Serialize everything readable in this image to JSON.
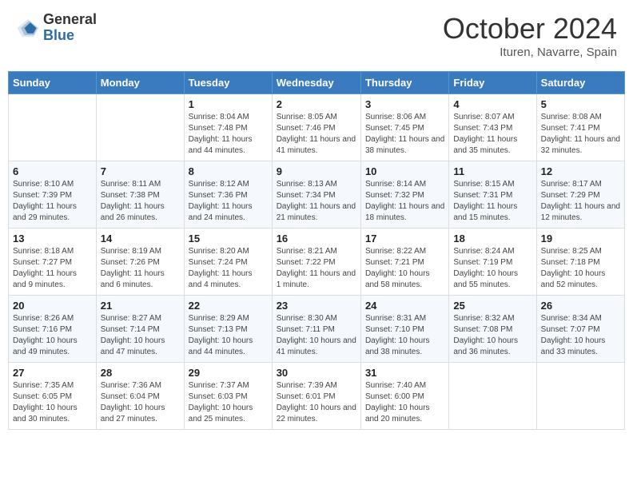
{
  "header": {
    "logo_general": "General",
    "logo_blue": "Blue",
    "month_title": "October 2024",
    "subtitle": "Ituren, Navarre, Spain"
  },
  "weekdays": [
    "Sunday",
    "Monday",
    "Tuesday",
    "Wednesday",
    "Thursday",
    "Friday",
    "Saturday"
  ],
  "weeks": [
    [
      null,
      null,
      {
        "day": "1",
        "sunrise": "Sunrise: 8:04 AM",
        "sunset": "Sunset: 7:48 PM",
        "daylight": "Daylight: 11 hours and 44 minutes."
      },
      {
        "day": "2",
        "sunrise": "Sunrise: 8:05 AM",
        "sunset": "Sunset: 7:46 PM",
        "daylight": "Daylight: 11 hours and 41 minutes."
      },
      {
        "day": "3",
        "sunrise": "Sunrise: 8:06 AM",
        "sunset": "Sunset: 7:45 PM",
        "daylight": "Daylight: 11 hours and 38 minutes."
      },
      {
        "day": "4",
        "sunrise": "Sunrise: 8:07 AM",
        "sunset": "Sunset: 7:43 PM",
        "daylight": "Daylight: 11 hours and 35 minutes."
      },
      {
        "day": "5",
        "sunrise": "Sunrise: 8:08 AM",
        "sunset": "Sunset: 7:41 PM",
        "daylight": "Daylight: 11 hours and 32 minutes."
      }
    ],
    [
      {
        "day": "6",
        "sunrise": "Sunrise: 8:10 AM",
        "sunset": "Sunset: 7:39 PM",
        "daylight": "Daylight: 11 hours and 29 minutes."
      },
      {
        "day": "7",
        "sunrise": "Sunrise: 8:11 AM",
        "sunset": "Sunset: 7:38 PM",
        "daylight": "Daylight: 11 hours and 26 minutes."
      },
      {
        "day": "8",
        "sunrise": "Sunrise: 8:12 AM",
        "sunset": "Sunset: 7:36 PM",
        "daylight": "Daylight: 11 hours and 24 minutes."
      },
      {
        "day": "9",
        "sunrise": "Sunrise: 8:13 AM",
        "sunset": "Sunset: 7:34 PM",
        "daylight": "Daylight: 11 hours and 21 minutes."
      },
      {
        "day": "10",
        "sunrise": "Sunrise: 8:14 AM",
        "sunset": "Sunset: 7:32 PM",
        "daylight": "Daylight: 11 hours and 18 minutes."
      },
      {
        "day": "11",
        "sunrise": "Sunrise: 8:15 AM",
        "sunset": "Sunset: 7:31 PM",
        "daylight": "Daylight: 11 hours and 15 minutes."
      },
      {
        "day": "12",
        "sunrise": "Sunrise: 8:17 AM",
        "sunset": "Sunset: 7:29 PM",
        "daylight": "Daylight: 11 hours and 12 minutes."
      }
    ],
    [
      {
        "day": "13",
        "sunrise": "Sunrise: 8:18 AM",
        "sunset": "Sunset: 7:27 PM",
        "daylight": "Daylight: 11 hours and 9 minutes."
      },
      {
        "day": "14",
        "sunrise": "Sunrise: 8:19 AM",
        "sunset": "Sunset: 7:26 PM",
        "daylight": "Daylight: 11 hours and 6 minutes."
      },
      {
        "day": "15",
        "sunrise": "Sunrise: 8:20 AM",
        "sunset": "Sunset: 7:24 PM",
        "daylight": "Daylight: 11 hours and 4 minutes."
      },
      {
        "day": "16",
        "sunrise": "Sunrise: 8:21 AM",
        "sunset": "Sunset: 7:22 PM",
        "daylight": "Daylight: 11 hours and 1 minute."
      },
      {
        "day": "17",
        "sunrise": "Sunrise: 8:22 AM",
        "sunset": "Sunset: 7:21 PM",
        "daylight": "Daylight: 10 hours and 58 minutes."
      },
      {
        "day": "18",
        "sunrise": "Sunrise: 8:24 AM",
        "sunset": "Sunset: 7:19 PM",
        "daylight": "Daylight: 10 hours and 55 minutes."
      },
      {
        "day": "19",
        "sunrise": "Sunrise: 8:25 AM",
        "sunset": "Sunset: 7:18 PM",
        "daylight": "Daylight: 10 hours and 52 minutes."
      }
    ],
    [
      {
        "day": "20",
        "sunrise": "Sunrise: 8:26 AM",
        "sunset": "Sunset: 7:16 PM",
        "daylight": "Daylight: 10 hours and 49 minutes."
      },
      {
        "day": "21",
        "sunrise": "Sunrise: 8:27 AM",
        "sunset": "Sunset: 7:14 PM",
        "daylight": "Daylight: 10 hours and 47 minutes."
      },
      {
        "day": "22",
        "sunrise": "Sunrise: 8:29 AM",
        "sunset": "Sunset: 7:13 PM",
        "daylight": "Daylight: 10 hours and 44 minutes."
      },
      {
        "day": "23",
        "sunrise": "Sunrise: 8:30 AM",
        "sunset": "Sunset: 7:11 PM",
        "daylight": "Daylight: 10 hours and 41 minutes."
      },
      {
        "day": "24",
        "sunrise": "Sunrise: 8:31 AM",
        "sunset": "Sunset: 7:10 PM",
        "daylight": "Daylight: 10 hours and 38 minutes."
      },
      {
        "day": "25",
        "sunrise": "Sunrise: 8:32 AM",
        "sunset": "Sunset: 7:08 PM",
        "daylight": "Daylight: 10 hours and 36 minutes."
      },
      {
        "day": "26",
        "sunrise": "Sunrise: 8:34 AM",
        "sunset": "Sunset: 7:07 PM",
        "daylight": "Daylight: 10 hours and 33 minutes."
      }
    ],
    [
      {
        "day": "27",
        "sunrise": "Sunrise: 7:35 AM",
        "sunset": "Sunset: 6:05 PM",
        "daylight": "Daylight: 10 hours and 30 minutes."
      },
      {
        "day": "28",
        "sunrise": "Sunrise: 7:36 AM",
        "sunset": "Sunset: 6:04 PM",
        "daylight": "Daylight: 10 hours and 27 minutes."
      },
      {
        "day": "29",
        "sunrise": "Sunrise: 7:37 AM",
        "sunset": "Sunset: 6:03 PM",
        "daylight": "Daylight: 10 hours and 25 minutes."
      },
      {
        "day": "30",
        "sunrise": "Sunrise: 7:39 AM",
        "sunset": "Sunset: 6:01 PM",
        "daylight": "Daylight: 10 hours and 22 minutes."
      },
      {
        "day": "31",
        "sunrise": "Sunrise: 7:40 AM",
        "sunset": "Sunset: 6:00 PM",
        "daylight": "Daylight: 10 hours and 20 minutes."
      },
      null,
      null
    ]
  ]
}
